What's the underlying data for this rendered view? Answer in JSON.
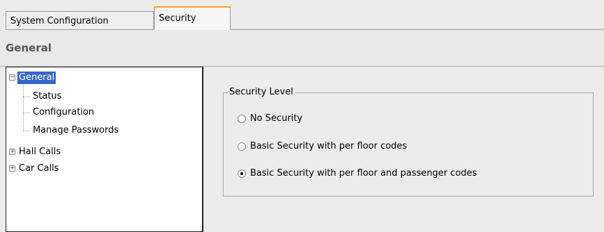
{
  "tabs": [
    {
      "label": "System Configuration",
      "active": false
    },
    {
      "label": "Security",
      "active": true
    }
  ],
  "header": {
    "title": "General"
  },
  "tree": {
    "nodes": [
      {
        "label": "General",
        "expanded": true,
        "selected": true
      },
      {
        "label": "Status"
      },
      {
        "label": "Configuration"
      },
      {
        "label": "Manage Passwords"
      },
      {
        "label": "Hall Calls",
        "expanded": false
      },
      {
        "label": "Car Calls",
        "expanded": false
      }
    ]
  },
  "security_level": {
    "title": "Security Level",
    "options": [
      {
        "label": "No Security",
        "selected": false
      },
      {
        "label": "Basic Security with per floor codes",
        "selected": false
      },
      {
        "label": "Basic Security with per floor and passenger codes",
        "selected": true
      }
    ]
  },
  "colors": {
    "active_tab_accent": "#f0a030",
    "selection": "#3a64c8"
  }
}
